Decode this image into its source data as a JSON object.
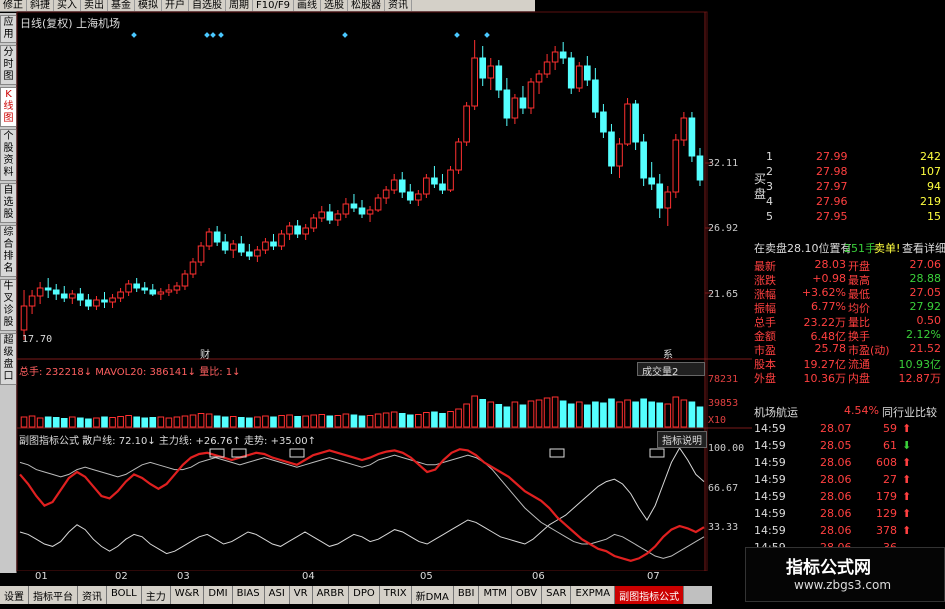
{
  "toolbar": [
    "修正",
    "斜捷",
    "买入",
    "卖出",
    "基金",
    "模拟",
    "开户",
    "自选股",
    "周期",
    "F10/F9",
    "画线",
    "选股",
    "松股器",
    "资讯"
  ],
  "sidebar": [
    {
      "label": "应用",
      "active": false
    },
    {
      "label": "分时图",
      "active": false
    },
    {
      "label": "K线图",
      "active": true
    },
    {
      "label": "个股资料",
      "active": false
    },
    {
      "label": "自选股",
      "active": false
    },
    {
      "label": "综合排名",
      "active": false
    },
    {
      "label": "牛叉诊股",
      "active": false
    },
    {
      "label": "超级盘口",
      "active": false
    }
  ],
  "chart": {
    "title": "日线(复权) 上海机场",
    "low_mark": "17.70",
    "ylabels": [
      "32.11",
      "26.92",
      "21.65"
    ],
    "markers": [
      "财",
      "系"
    ],
    "candles": [
      [
        20,
        22,
        19.5,
        21.2
      ],
      [
        21.2,
        22,
        20.8,
        21.7
      ],
      [
        21.7,
        22.4,
        21.3,
        22.1
      ],
      [
        22.1,
        22.6,
        21.6,
        22
      ],
      [
        22,
        22.3,
        21.5,
        21.8
      ],
      [
        21.8,
        22.2,
        21.4,
        21.6
      ],
      [
        21.6,
        22,
        21.3,
        21.8
      ],
      [
        21.8,
        22.1,
        21.2,
        21.5
      ],
      [
        21.5,
        21.8,
        21,
        21.2
      ],
      [
        21.2,
        21.7,
        21,
        21.5
      ],
      [
        21.5,
        21.9,
        21.1,
        21.4
      ],
      [
        21.4,
        21.8,
        21.1,
        21.6
      ],
      [
        21.6,
        22.1,
        21.4,
        21.9
      ],
      [
        21.9,
        22.5,
        21.7,
        22.3
      ],
      [
        22.3,
        22.6,
        21.9,
        22.1
      ],
      [
        22.1,
        22.4,
        21.8,
        22
      ],
      [
        22,
        22.3,
        21.7,
        21.8
      ],
      [
        21.8,
        22.1,
        21.5,
        21.9
      ],
      [
        21.9,
        22.3,
        21.7,
        22
      ],
      [
        22,
        22.4,
        21.8,
        22.2
      ],
      [
        22.2,
        23,
        22,
        22.8
      ],
      [
        22.8,
        23.6,
        22.6,
        23.4
      ],
      [
        23.4,
        24.4,
        23.2,
        24.2
      ],
      [
        24.2,
        25.1,
        24,
        24.9
      ],
      [
        24.9,
        25.2,
        24.2,
        24.4
      ],
      [
        24.4,
        24.8,
        23.8,
        24
      ],
      [
        24,
        24.5,
        23.6,
        24.3
      ],
      [
        24.3,
        24.7,
        23.7,
        23.9
      ],
      [
        23.9,
        24.3,
        23.5,
        23.7
      ],
      [
        23.7,
        24.2,
        23.4,
        24
      ],
      [
        24,
        24.6,
        23.8,
        24.4
      ],
      [
        24.4,
        24.8,
        24,
        24.2
      ],
      [
        24.2,
        25,
        24,
        24.8
      ],
      [
        24.8,
        25.4,
        24.5,
        25.2
      ],
      [
        25.2,
        25.5,
        24.6,
        24.8
      ],
      [
        24.8,
        25.3,
        24.5,
        25.1
      ],
      [
        25.1,
        25.8,
        24.9,
        25.6
      ],
      [
        25.6,
        26.2,
        25.4,
        25.9
      ],
      [
        25.9,
        26.3,
        25.3,
        25.5
      ],
      [
        25.5,
        26,
        25.2,
        25.8
      ],
      [
        25.8,
        26.6,
        25.6,
        26.3
      ],
      [
        26.3,
        26.8,
        25.9,
        26.1
      ],
      [
        26.1,
        26.5,
        25.6,
        25.8
      ],
      [
        25.8,
        26.2,
        25.4,
        26
      ],
      [
        26,
        26.8,
        25.9,
        26.6
      ],
      [
        26.6,
        27.2,
        26.3,
        27
      ],
      [
        27,
        27.8,
        26.8,
        27.5
      ],
      [
        27.5,
        27.9,
        26.6,
        26.9
      ],
      [
        26.9,
        27.3,
        26.3,
        26.5
      ],
      [
        26.5,
        27,
        26.2,
        26.8
      ],
      [
        26.8,
        27.8,
        26.6,
        27.6
      ],
      [
        27.6,
        28.2,
        27.1,
        27.3
      ],
      [
        27.3,
        27.8,
        26.8,
        27
      ],
      [
        27,
        28.2,
        26.9,
        28
      ],
      [
        28,
        29.6,
        27.8,
        29.4
      ],
      [
        29.4,
        31.4,
        29.2,
        31.2
      ],
      [
        31.2,
        34.5,
        31,
        33.6
      ],
      [
        33.6,
        34.2,
        32.2,
        32.6
      ],
      [
        32.6,
        33.6,
        32,
        33.2
      ],
      [
        33.2,
        33.5,
        31.6,
        32
      ],
      [
        32,
        32.6,
        30.2,
        30.6
      ],
      [
        30.6,
        31.8,
        30.3,
        31.6
      ],
      [
        31.6,
        32.2,
        30.8,
        31.1
      ],
      [
        31.1,
        32.6,
        30.8,
        32.4
      ],
      [
        32.4,
        33,
        31.8,
        32.8
      ],
      [
        32.8,
        33.8,
        32.6,
        33.4
      ],
      [
        33.4,
        34.2,
        33,
        33.9
      ],
      [
        33.9,
        34.4,
        33.3,
        33.6
      ],
      [
        33.6,
        33.9,
        31.8,
        32.1
      ],
      [
        32.1,
        33.4,
        31.9,
        33.2
      ],
      [
        33.2,
        33.7,
        32.2,
        32.5
      ],
      [
        32.5,
        33.1,
        30.6,
        30.9
      ],
      [
        30.9,
        31.3,
        29.6,
        29.9
      ],
      [
        29.9,
        30.3,
        27.8,
        28.2
      ],
      [
        28.2,
        29.6,
        27.6,
        29.3
      ],
      [
        29.3,
        31.6,
        29.2,
        31.3
      ],
      [
        31.3,
        31.5,
        29,
        29.4
      ],
      [
        29.4,
        29.8,
        27.2,
        27.6
      ],
      [
        27.6,
        28.4,
        27,
        27.3
      ],
      [
        27.3,
        27.8,
        25.6,
        26.1
      ],
      [
        26.1,
        27.2,
        25.2,
        26.9
      ],
      [
        26.9,
        29.8,
        26.6,
        29.5
      ],
      [
        29.5,
        30.9,
        29.2,
        30.6
      ],
      [
        30.6,
        30.9,
        28.4,
        28.7
      ],
      [
        28.7,
        29.1,
        27.2,
        27.5
      ]
    ]
  },
  "volume": {
    "header": "总手: 232218↓  MAVOL20: 386141↓  量比: 1↓",
    "dropdown": "成交量2",
    "ylabels": [
      "78231",
      "39853",
      "X10"
    ],
    "bars": [
      0.2,
      0.22,
      0.18,
      0.2,
      0.19,
      0.17,
      0.2,
      0.18,
      0.16,
      0.18,
      0.2,
      0.19,
      0.21,
      0.23,
      0.2,
      0.18,
      0.19,
      0.2,
      0.18,
      0.2,
      0.22,
      0.24,
      0.27,
      0.26,
      0.22,
      0.2,
      0.21,
      0.19,
      0.18,
      0.2,
      0.22,
      0.2,
      0.23,
      0.24,
      0.21,
      0.22,
      0.24,
      0.25,
      0.22,
      0.23,
      0.26,
      0.24,
      0.22,
      0.23,
      0.26,
      0.28,
      0.3,
      0.27,
      0.24,
      0.25,
      0.29,
      0.3,
      0.27,
      0.31,
      0.36,
      0.46,
      0.62,
      0.55,
      0.5,
      0.45,
      0.4,
      0.5,
      0.44,
      0.52,
      0.54,
      0.58,
      0.6,
      0.52,
      0.46,
      0.5,
      0.44,
      0.5,
      0.48,
      0.56,
      0.5,
      0.54,
      0.5,
      0.56,
      0.5,
      0.48,
      0.46,
      0.6,
      0.54,
      0.5,
      0.4
    ]
  },
  "indicator": {
    "header": "副图指标公式 散户线: 72.10↓ 主力线: +26.76↑ 走势: +35.00↑",
    "button": "指标说明",
    "ylabels": [
      "100.00",
      "66.67",
      "33.33"
    ],
    "red": [
      78,
      70,
      60,
      52,
      55,
      65,
      75,
      80,
      76,
      68,
      60,
      58,
      64,
      72,
      78,
      75,
      70,
      66,
      70,
      78,
      86,
      92,
      95,
      96,
      94,
      92,
      90,
      92,
      94,
      96,
      95,
      92,
      90,
      88,
      86,
      90,
      94,
      96,
      98,
      96,
      94,
      92,
      90,
      92,
      95,
      97,
      98,
      96,
      92,
      86,
      80,
      82,
      90,
      96,
      99,
      98,
      94,
      88,
      84,
      80,
      76,
      70,
      64,
      60,
      56,
      50,
      42,
      36,
      30,
      24,
      20,
      16,
      14,
      10,
      8,
      6,
      8,
      12,
      18,
      26,
      32,
      35,
      33,
      30,
      34
    ],
    "white": [
      30,
      28,
      24,
      20,
      18,
      22,
      30,
      36,
      32,
      24,
      18,
      14,
      18,
      24,
      28,
      26,
      20,
      16,
      12,
      14,
      18,
      22,
      26,
      28,
      24,
      20,
      22,
      26,
      30,
      28,
      24,
      20,
      18,
      22,
      26,
      30,
      26,
      22,
      18,
      20,
      24,
      28,
      26,
      22,
      24,
      28,
      32,
      30,
      26,
      22,
      20,
      24,
      28,
      32,
      36,
      40,
      38,
      34,
      30,
      26,
      24,
      22,
      20,
      24,
      30,
      36,
      40,
      44,
      50,
      56,
      62,
      68,
      72,
      74,
      70,
      62,
      50,
      40,
      52,
      70,
      88,
      100,
      90,
      78,
      72
    ],
    "thin": [
      88,
      86,
      82,
      80,
      78,
      76,
      78,
      82,
      84,
      82,
      80,
      78,
      76,
      78,
      82,
      86,
      88,
      86,
      84,
      82,
      82,
      84,
      88,
      90,
      92,
      90,
      88,
      86,
      88,
      90,
      92,
      90,
      88,
      86,
      84,
      86,
      88,
      90,
      92,
      90,
      88,
      86,
      84,
      86,
      90,
      92,
      94,
      92,
      90,
      88,
      86,
      86,
      88,
      90,
      92,
      94,
      92,
      88,
      82,
      74,
      66,
      58,
      50,
      44,
      38,
      34,
      30,
      26,
      22,
      20,
      20,
      22,
      24,
      28,
      26,
      22,
      18,
      14,
      10,
      8,
      10,
      14,
      18,
      22,
      26
    ]
  },
  "months": [
    [
      "01",
      18
    ],
    [
      "02",
      98
    ],
    [
      "03",
      160
    ],
    [
      "04",
      285
    ],
    [
      "05",
      403
    ],
    [
      "06",
      515
    ],
    [
      "07",
      630
    ]
  ],
  "bottom_tabs": [
    "设置",
    "指标平台",
    "资讯",
    "BOLL",
    "主力",
    "W&R",
    "DMI",
    "BIAS",
    "ASI",
    "VR",
    "ARBR",
    "DPO",
    "TRIX",
    "新DMA",
    "BBI",
    "MTM",
    "OBV",
    "SAR",
    "EXPMA",
    "副图指标公式"
  ],
  "orderbook": [
    [
      "1",
      "27.99",
      "242"
    ],
    [
      "2",
      "27.98",
      "107"
    ],
    [
      "3",
      "27.97",
      "94"
    ],
    [
      "4",
      "27.96",
      "219"
    ],
    [
      "5",
      "27.95",
      "15"
    ]
  ],
  "book_side": "买盘",
  "pending": {
    "left": "在卖盘28.10位置有",
    "qty": "251手",
    "sell": "卖单!",
    "detail": "查看详细"
  },
  "quote": [
    [
      "最新",
      "28.03",
      "开盘",
      "27.06"
    ],
    [
      "涨跌",
      "+0.98",
      "最高",
      "28.88"
    ],
    [
      "涨幅",
      "+3.62%",
      "最低",
      "27.05"
    ],
    [
      "振幅",
      "6.77%",
      "均价",
      "27.92"
    ],
    [
      "总手",
      "23.22万",
      "量比",
      "0.50"
    ],
    [
      "金额",
      "6.48亿",
      "换手",
      "2.12%"
    ],
    [
      "市盈",
      "25.78",
      "市盈(动)",
      "21.52"
    ],
    [
      "股本",
      "19.27亿",
      "流通",
      "10.93亿"
    ],
    [
      "外盘",
      "10.36万",
      "内盘",
      "12.87万"
    ]
  ],
  "sector": {
    "name": "机场航运",
    "pct": "4.54%",
    "compare": "同行业比较"
  },
  "ticks": [
    [
      "14:59",
      "28.07",
      "59",
      "up"
    ],
    [
      "14:59",
      "28.05",
      "61",
      "down"
    ],
    [
      "14:59",
      "28.06",
      "608",
      "up"
    ],
    [
      "14:59",
      "28.06",
      "27",
      "up"
    ],
    [
      "14:59",
      "28.06",
      "179",
      "up"
    ],
    [
      "14:59",
      "28.06",
      "129",
      "up"
    ],
    [
      "14:59",
      "28.06",
      "378",
      "up"
    ],
    [
      "14:59",
      "28.06",
      "36",
      ""
    ]
  ],
  "watermark": {
    "title": "指标公式网",
    "url": "www.zbgs3.com"
  },
  "colors": {
    "up": "#ff3030",
    "down": "#54ffff",
    "ind_red": "#e02020",
    "ind_white": "#e0e0e0"
  }
}
